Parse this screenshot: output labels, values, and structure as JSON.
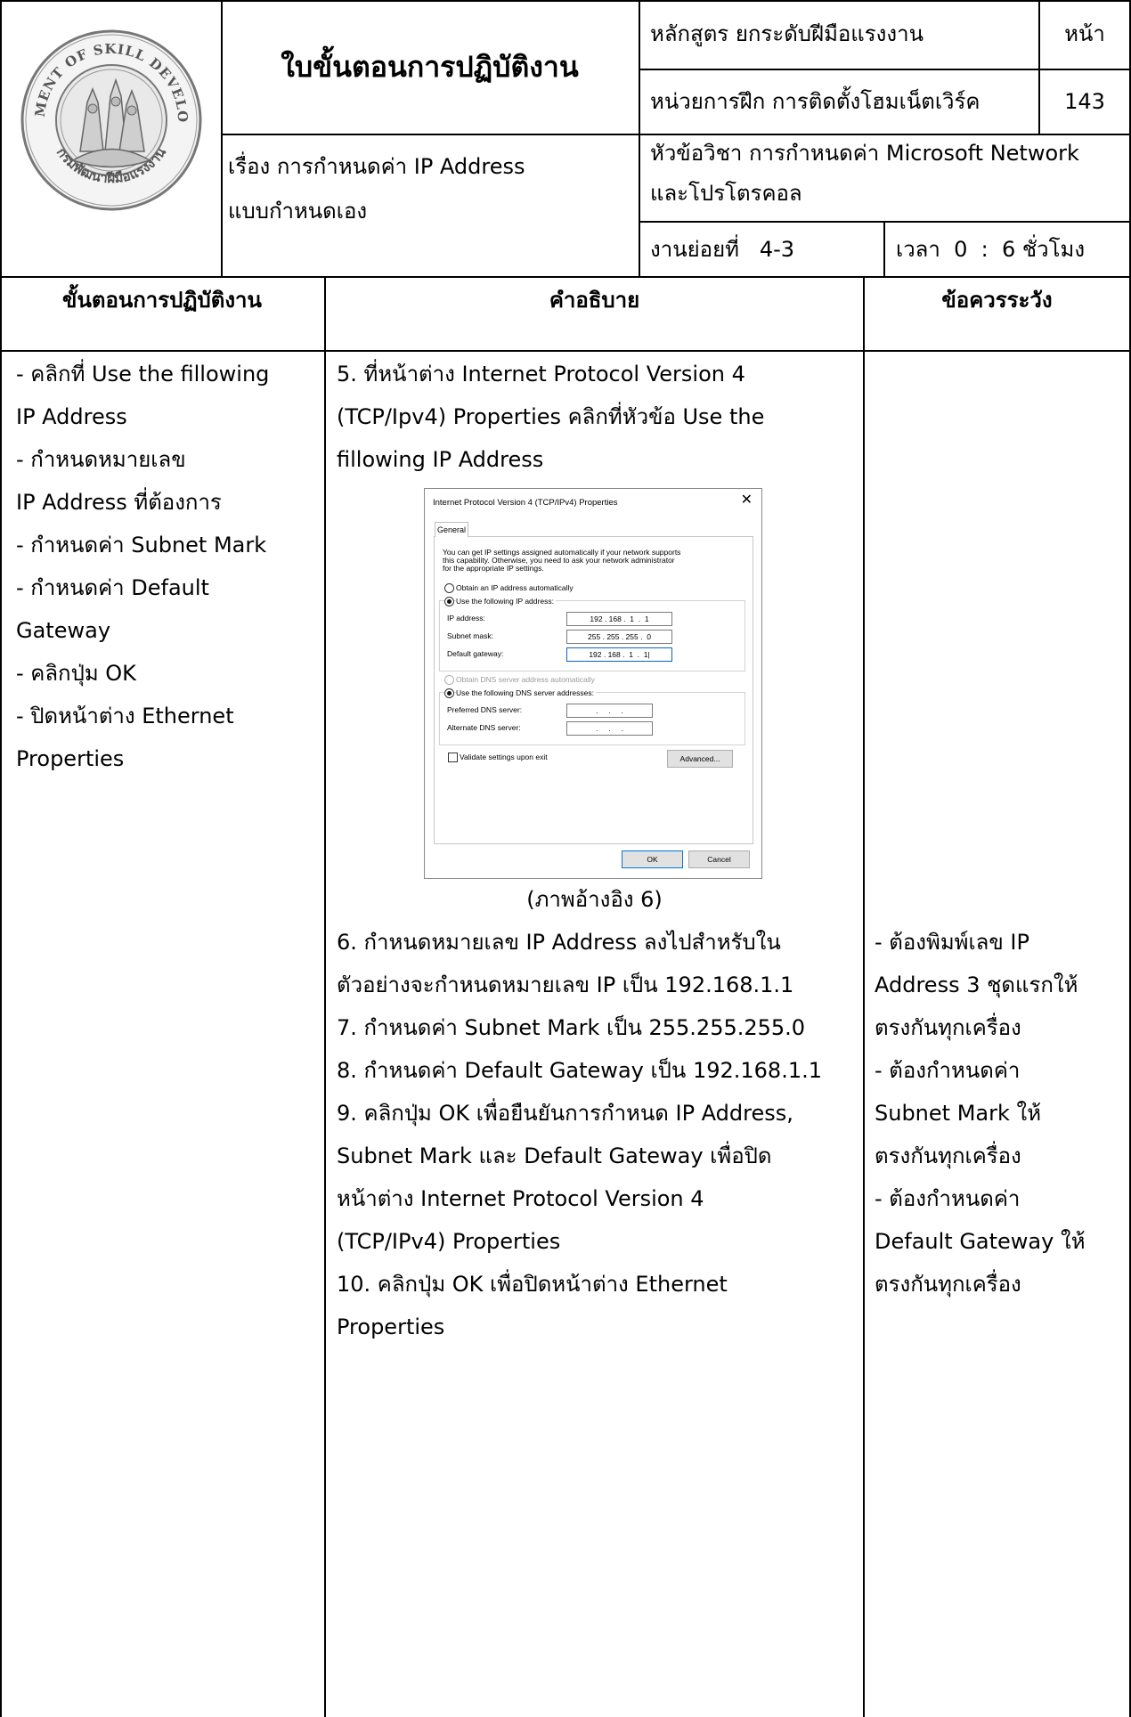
{
  "header": {
    "logo_text_top": "DEPARTMENT OF SKILL DEVELOPMENT",
    "logo_text_bottom": "กรมพัฒนาฝีมือแรงงาน",
    "sheet_title": "ใบขั้นตอนการปฏิบัติงาน",
    "course": "หลักสูตร ยกระดับฝีมือแรงงาน",
    "page_label": "หน้า",
    "unit": "หน่วยการฝึก การติดตั้งโฮมเน็ตเวิร์ค",
    "page_number": "143",
    "subject_line1": "เรื่อง การกำหนดค่า IP Address",
    "subject_line2": "แบบกำหนดเอง",
    "topic_line1": "หัวข้อวิชา การกำหนดค่า Microsoft Network",
    "topic_line2": "และโปรโตรคอล",
    "subtask": "งานย่อยที่   4-3",
    "time": "เวลา  0  :  6 ชั่วโมง"
  },
  "columns": {
    "steps": "ขั้นตอนการปฏิบัติงาน",
    "description": "คำอธิบาย",
    "caution": "ข้อควรระวัง"
  },
  "steps": [
    "- คลิกที่ Use the fillowing",
    "IP Address",
    "- กำหนดหมายเลข",
    "IP Address ที่ต้องการ",
    "- กำหนดค่า Subnet Mark",
    "- กำหนดค่า Default",
    "Gateway",
    "- คลิกปุ่ม OK",
    "- ปิดหน้าต่าง Ethernet",
    "Properties"
  ],
  "description_top": [
    "5. ที่หน้าต่าง Internet Protocol Version 4",
    "(TCP/Ipv4) Properties คลิกที่หัวข้อ Use the",
    "fillowing IP Address"
  ],
  "image_caption": "(ภาพอ้างอิง 6)",
  "description_bottom": [
    "6. กำหนดหมายเลข IP Address ลงไปสำหรับใน",
    "ตัวอย่างจะกำหนดหมายเลข IP เป็น 192.168.1.1",
    "7. กำหนดค่า Subnet Mark เป็น 255.255.255.0",
    "8. กำหนดค่า Default Gateway เป็น 192.168.1.1",
    "9. คลิกปุ่ม OK เพื่อยืนยันการกำหนด IP Address,",
    "Subnet Mark และ Default Gateway เพื่อปิด",
    "หน้าต่าง Internet Protocol Version 4",
    "(TCP/IPv4) Properties",
    "10. คลิกปุ่ม OK เพื่อปิดหน้าต่าง Ethernet",
    "Properties"
  ],
  "caution": [
    "- ต้องพิมพ์เลข IP",
    "Address 3 ชุดแรกให้",
    "ตรงกันทุกเครื่อง",
    "- ต้องกำหนดค่า",
    "Subnet Mark ให้",
    "ตรงกันทุกเครื่อง",
    "- ต้องกำหนดค่า",
    "Default Gateway ให้",
    "ตรงกันทุกเครื่อง"
  ],
  "dialog": {
    "title": "Internet Protocol Version 4 (TCP/IPv4) Properties",
    "close": "✕",
    "tab": "General",
    "info": [
      "You can get IP settings assigned automatically if your network supports",
      "this capability. Otherwise, you need to ask your network administrator",
      "for the appropriate IP settings."
    ],
    "obtain_ip": "Obtain an IP address automatically",
    "use_ip": "Use the following IP address:",
    "ip_label": "IP address:",
    "ip_value": "192 . 168 .  1  .  1",
    "mask_label": "Subnet mask:",
    "mask_value": "255 . 255 . 255 .  0",
    "gateway_label": "Default gateway:",
    "gateway_value": "192 . 168 .  1  .  1|",
    "obtain_dns": "Obtain DNS server address automatically",
    "use_dns": "Use the following DNS server addresses:",
    "preferred_label": "Preferred DNS server:",
    "preferred_value": "   .     .     .   ",
    "alternate_label": "Alternate DNS server:",
    "alternate_value": "   .     .     .   ",
    "validate": "Validate settings upon exit",
    "advanced": "Advanced...",
    "ok": "OK",
    "cancel": "Cancel"
  }
}
